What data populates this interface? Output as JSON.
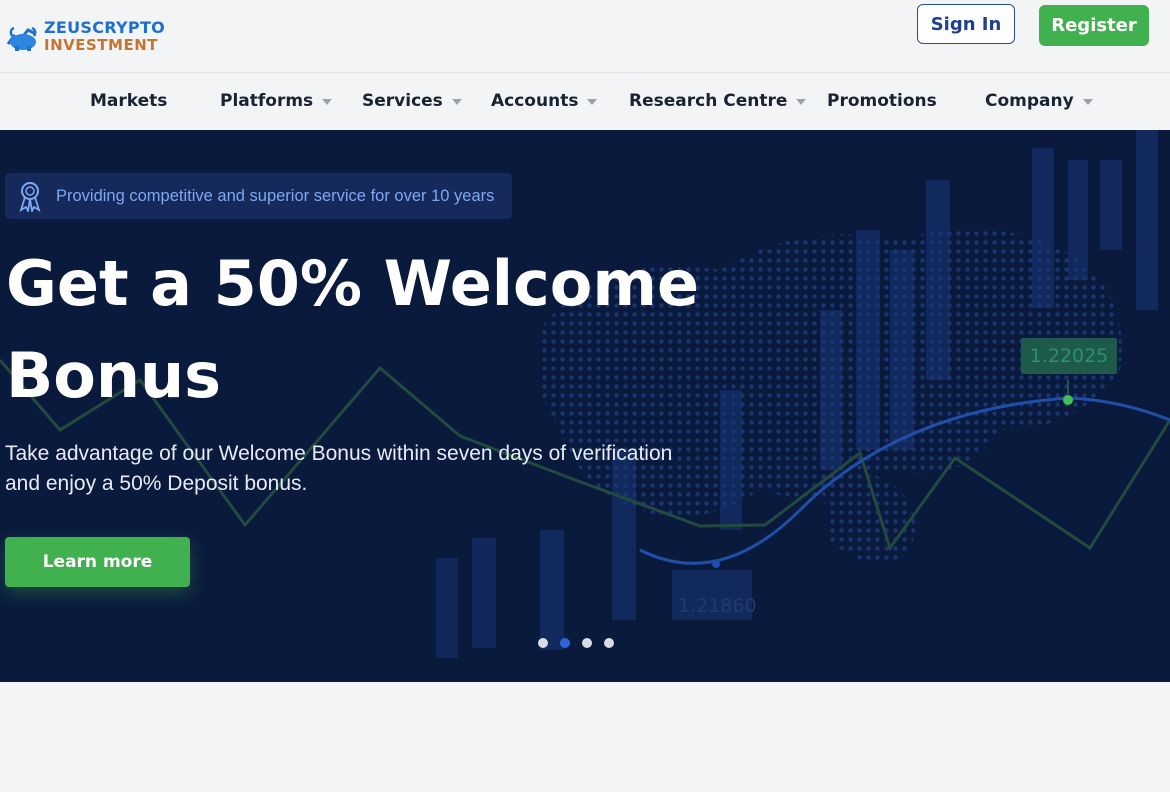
{
  "brand": {
    "line1": "ZEUSCRYPTO",
    "line2": "INVESTMENT"
  },
  "header": {
    "signin_label": "Sign In",
    "register_label": "Register"
  },
  "nav": {
    "items": [
      {
        "label": "Markets",
        "dropdown": false
      },
      {
        "label": "Platforms",
        "dropdown": true
      },
      {
        "label": "Services",
        "dropdown": true
      },
      {
        "label": "Accounts",
        "dropdown": true
      },
      {
        "label": "Research Centre",
        "dropdown": true
      },
      {
        "label": "Promotions",
        "dropdown": false
      },
      {
        "label": "Company",
        "dropdown": true
      }
    ]
  },
  "hero": {
    "badge_text": "Providing competitive and superior service for over 10 years",
    "title_line1": "Get a 50% Welcome",
    "title_line2": "Bonus",
    "subtitle_line1": "Take advantage of our Welcome Bonus within seven days of verification",
    "subtitle_line2": "and enjoy a 50% Deposit bonus.",
    "cta_label": "Learn more",
    "price_high": "1.22025",
    "price_low": "1.21860",
    "slides_total": 4,
    "active_slide": 2
  },
  "below_fold": {
    "heading_partial": ""
  },
  "colors": {
    "accent_green": "#41b04e",
    "brand_blue": "#1f6fd1",
    "brand_orange": "#c7742c",
    "hero_bg": "#0a1a3d"
  }
}
